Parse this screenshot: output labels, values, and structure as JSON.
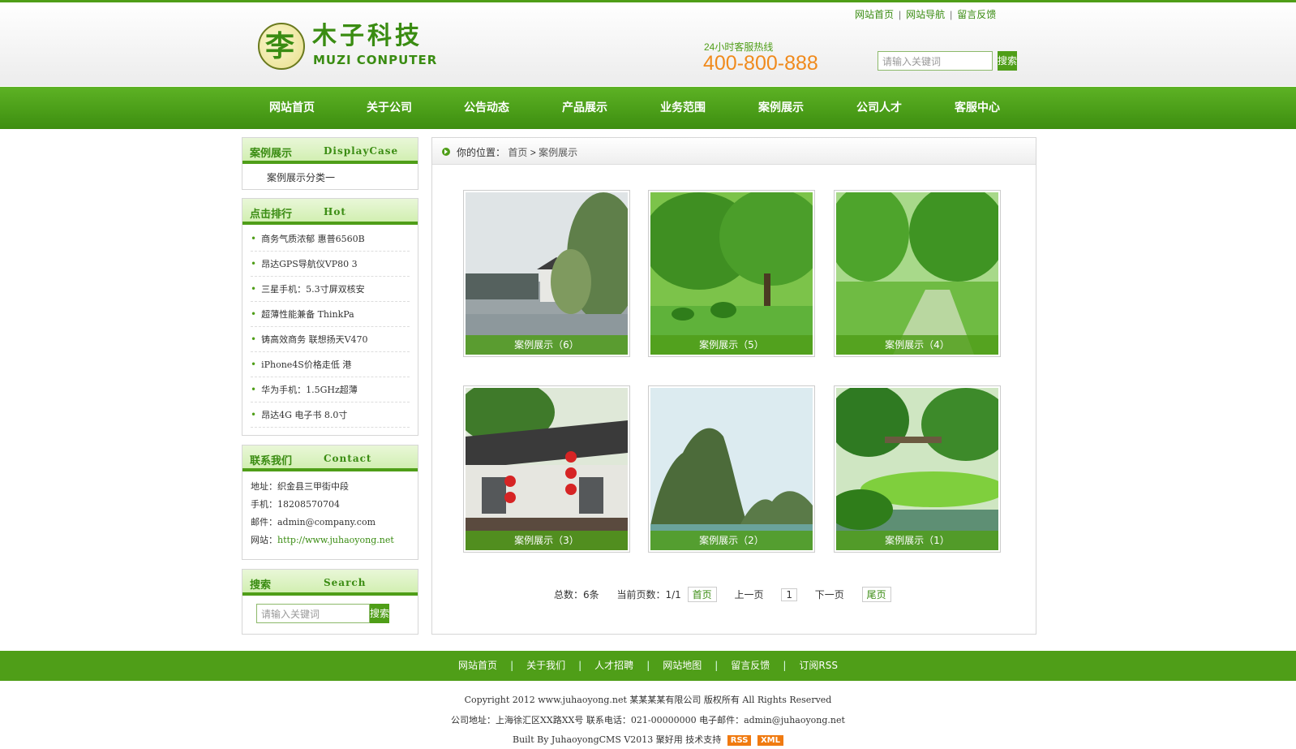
{
  "header": {
    "logo_glyph": "李",
    "logo_cn": "木子科技",
    "logo_en": "MUZI CONPUTER",
    "hotline_label": "24小时客服热线",
    "hotline_number": "400-800-888",
    "toplinks": [
      "网站首页",
      "网站导航",
      "留言反馈"
    ],
    "search_placeholder": "请输入关键词",
    "search_button": "搜索"
  },
  "nav": [
    "网站首页",
    "关于公司",
    "公告动态",
    "产品展示",
    "业务范围",
    "案例展示",
    "公司人才",
    "客服中心"
  ],
  "sidebar": {
    "category": {
      "title": "案例展示",
      "sub": "DisplayCase",
      "items": [
        "案例展示分类一"
      ]
    },
    "hot": {
      "title": "点击排行",
      "sub": "Hot",
      "items": [
        "商务气质浓郁 惠普6560B",
        "昂达GPS导航仪VP80 3",
        "三星手机：5.3寸屏双核安",
        "超薄性能兼备 ThinkPa",
        "铸高效商务 联想扬天V470",
        "iPhone4S价格走低 港",
        "华为手机：1.5GHz超薄",
        "昂达4G 电子书 8.0寸"
      ]
    },
    "contact": {
      "title": "联系我们",
      "sub": "Contact",
      "address_label": "地址：",
      "address": "织金县三甲街中段",
      "phone_label": "手机：",
      "phone": "18208570704",
      "email_label": "邮件：",
      "email": "admin@company.com",
      "site_label": "网站：",
      "site": "http://www.juhaoyong.net"
    },
    "search": {
      "title": "搜索",
      "sub": "Search",
      "placeholder": "请输入关键词",
      "button": "搜索"
    }
  },
  "breadcrumb": {
    "label": "你的位置：",
    "home": "首页",
    "sep": ">",
    "current": "案例展示"
  },
  "cases": [
    "案例展示（6）",
    "案例展示（5）",
    "案例展示（4）",
    "案例展示（3）",
    "案例展示（2）",
    "案例展示（1）"
  ],
  "pager": {
    "total": "总数：6条",
    "current": "当前页数：1/1",
    "first": "首页",
    "prev": "上一页",
    "page": "1",
    "next": "下一页",
    "last": "尾页"
  },
  "footer": {
    "links": [
      "网站首页",
      "关于我们",
      "人才招聘",
      "网站地图",
      "留言反馈",
      "订阅RSS"
    ],
    "copyright": "Copyright 2012 www.juhaoyong.net 某某某某有限公司 版权所有 All Rights Reserved",
    "address": "公司地址：上海徐汇区XX路XX号 联系电话：021-00000000 电子邮件：admin@juhaoyong.net",
    "built": "Built By JuhaoyongCMS V2013 聚好用 技术支持",
    "badges": [
      "RSS",
      "XML"
    ]
  },
  "colors": {
    "brand_green": "#4f9e18",
    "hotline_orange": "#f08a1c"
  }
}
